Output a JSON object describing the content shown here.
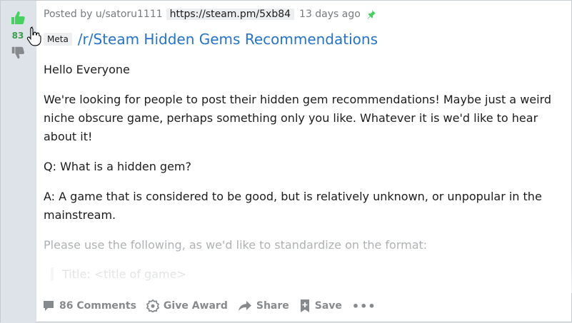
{
  "colors": {
    "upvote": "#46d160",
    "vote_count": "#3a9d4e",
    "title_link": "#2673c8",
    "pin": "#46d160",
    "muted": "#878a8c"
  },
  "vote": {
    "count": "83",
    "up_icon": "thumbs-up-icon",
    "down_icon": "thumbs-down-icon"
  },
  "post": {
    "posted_by": "Posted by u/satoru1111",
    "link": "https://steam.pm/5xb84",
    "age": "13 days ago",
    "pin_icon": "pin-icon",
    "flair": "Meta",
    "title": "/r/Steam Hidden Gems Recommendations",
    "body": [
      "Hello Everyone",
      "We're looking for people to post their hidden gem recommendations! Maybe just a weird niche obscure game, perhaps something only you like. Whatever it is we'd like to hear about it!",
      "Q: What is a hidden gem?",
      "A: A game that is considered to be good, but is relatively unknown, or unpopular in the mainstream.",
      "Please use the following, as we'd like to standardize on the format:"
    ],
    "quote": "Title: <title of game>"
  },
  "actions": {
    "comments": "86 Comments",
    "award": "Give Award",
    "share": "Share",
    "save": "Save",
    "more": "•••"
  }
}
